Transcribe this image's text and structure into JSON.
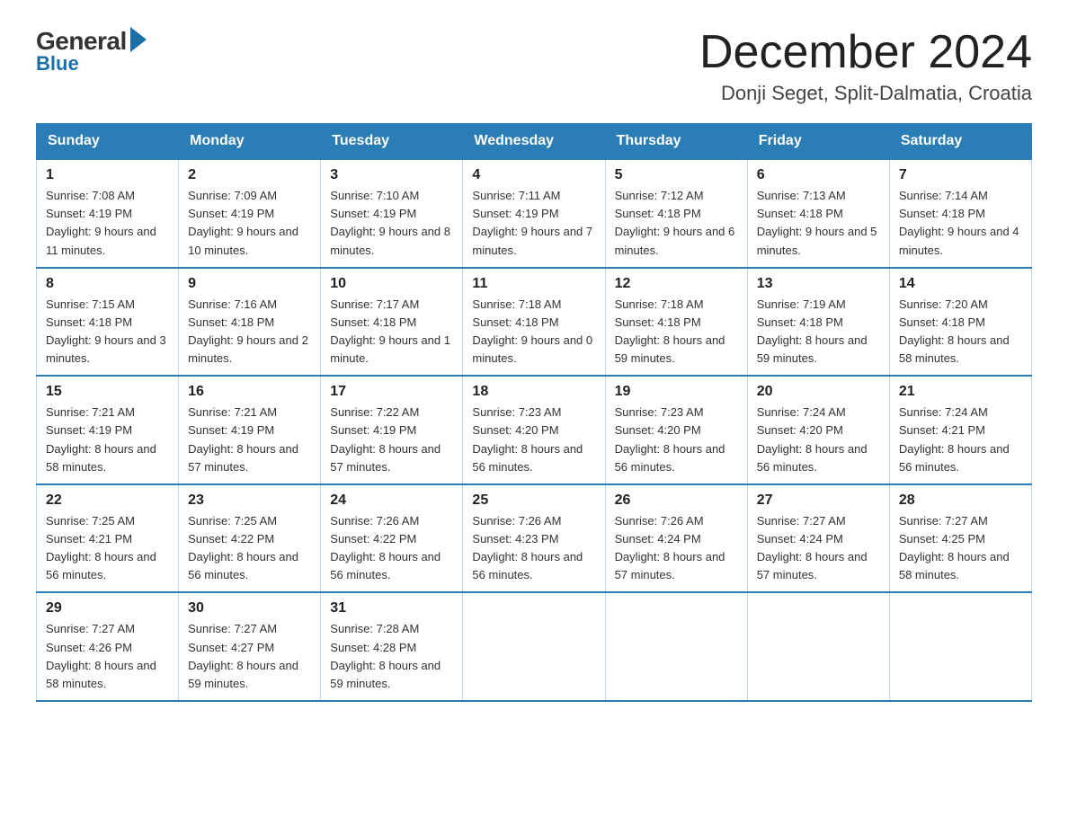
{
  "header": {
    "logo_general": "General",
    "logo_blue": "Blue",
    "month_title": "December 2024",
    "location": "Donji Seget, Split-Dalmatia, Croatia"
  },
  "weekdays": [
    "Sunday",
    "Monday",
    "Tuesday",
    "Wednesday",
    "Thursday",
    "Friday",
    "Saturday"
  ],
  "weeks": [
    [
      {
        "day": "1",
        "sunrise": "7:08 AM",
        "sunset": "4:19 PM",
        "daylight": "9 hours and 11 minutes."
      },
      {
        "day": "2",
        "sunrise": "7:09 AM",
        "sunset": "4:19 PM",
        "daylight": "9 hours and 10 minutes."
      },
      {
        "day": "3",
        "sunrise": "7:10 AM",
        "sunset": "4:19 PM",
        "daylight": "9 hours and 8 minutes."
      },
      {
        "day": "4",
        "sunrise": "7:11 AM",
        "sunset": "4:19 PM",
        "daylight": "9 hours and 7 minutes."
      },
      {
        "day": "5",
        "sunrise": "7:12 AM",
        "sunset": "4:18 PM",
        "daylight": "9 hours and 6 minutes."
      },
      {
        "day": "6",
        "sunrise": "7:13 AM",
        "sunset": "4:18 PM",
        "daylight": "9 hours and 5 minutes."
      },
      {
        "day": "7",
        "sunrise": "7:14 AM",
        "sunset": "4:18 PM",
        "daylight": "9 hours and 4 minutes."
      }
    ],
    [
      {
        "day": "8",
        "sunrise": "7:15 AM",
        "sunset": "4:18 PM",
        "daylight": "9 hours and 3 minutes."
      },
      {
        "day": "9",
        "sunrise": "7:16 AM",
        "sunset": "4:18 PM",
        "daylight": "9 hours and 2 minutes."
      },
      {
        "day": "10",
        "sunrise": "7:17 AM",
        "sunset": "4:18 PM",
        "daylight": "9 hours and 1 minute."
      },
      {
        "day": "11",
        "sunrise": "7:18 AM",
        "sunset": "4:18 PM",
        "daylight": "9 hours and 0 minutes."
      },
      {
        "day": "12",
        "sunrise": "7:18 AM",
        "sunset": "4:18 PM",
        "daylight": "8 hours and 59 minutes."
      },
      {
        "day": "13",
        "sunrise": "7:19 AM",
        "sunset": "4:18 PM",
        "daylight": "8 hours and 59 minutes."
      },
      {
        "day": "14",
        "sunrise": "7:20 AM",
        "sunset": "4:18 PM",
        "daylight": "8 hours and 58 minutes."
      }
    ],
    [
      {
        "day": "15",
        "sunrise": "7:21 AM",
        "sunset": "4:19 PM",
        "daylight": "8 hours and 58 minutes."
      },
      {
        "day": "16",
        "sunrise": "7:21 AM",
        "sunset": "4:19 PM",
        "daylight": "8 hours and 57 minutes."
      },
      {
        "day": "17",
        "sunrise": "7:22 AM",
        "sunset": "4:19 PM",
        "daylight": "8 hours and 57 minutes."
      },
      {
        "day": "18",
        "sunrise": "7:23 AM",
        "sunset": "4:20 PM",
        "daylight": "8 hours and 56 minutes."
      },
      {
        "day": "19",
        "sunrise": "7:23 AM",
        "sunset": "4:20 PM",
        "daylight": "8 hours and 56 minutes."
      },
      {
        "day": "20",
        "sunrise": "7:24 AM",
        "sunset": "4:20 PM",
        "daylight": "8 hours and 56 minutes."
      },
      {
        "day": "21",
        "sunrise": "7:24 AM",
        "sunset": "4:21 PM",
        "daylight": "8 hours and 56 minutes."
      }
    ],
    [
      {
        "day": "22",
        "sunrise": "7:25 AM",
        "sunset": "4:21 PM",
        "daylight": "8 hours and 56 minutes."
      },
      {
        "day": "23",
        "sunrise": "7:25 AM",
        "sunset": "4:22 PM",
        "daylight": "8 hours and 56 minutes."
      },
      {
        "day": "24",
        "sunrise": "7:26 AM",
        "sunset": "4:22 PM",
        "daylight": "8 hours and 56 minutes."
      },
      {
        "day": "25",
        "sunrise": "7:26 AM",
        "sunset": "4:23 PM",
        "daylight": "8 hours and 56 minutes."
      },
      {
        "day": "26",
        "sunrise": "7:26 AM",
        "sunset": "4:24 PM",
        "daylight": "8 hours and 57 minutes."
      },
      {
        "day": "27",
        "sunrise": "7:27 AM",
        "sunset": "4:24 PM",
        "daylight": "8 hours and 57 minutes."
      },
      {
        "day": "28",
        "sunrise": "7:27 AM",
        "sunset": "4:25 PM",
        "daylight": "8 hours and 58 minutes."
      }
    ],
    [
      {
        "day": "29",
        "sunrise": "7:27 AM",
        "sunset": "4:26 PM",
        "daylight": "8 hours and 58 minutes."
      },
      {
        "day": "30",
        "sunrise": "7:27 AM",
        "sunset": "4:27 PM",
        "daylight": "8 hours and 59 minutes."
      },
      {
        "day": "31",
        "sunrise": "7:28 AM",
        "sunset": "4:28 PM",
        "daylight": "8 hours and 59 minutes."
      },
      null,
      null,
      null,
      null
    ]
  ]
}
